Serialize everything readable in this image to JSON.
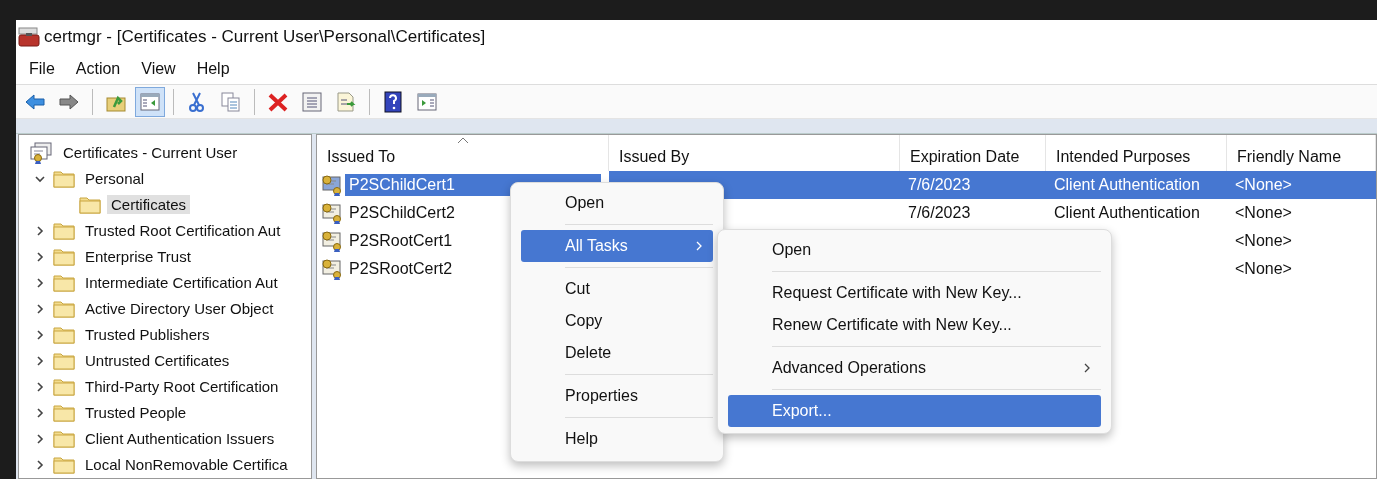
{
  "window": {
    "title": "certmgr - [Certificates - Current User\\Personal\\Certificates]"
  },
  "menu_bar": [
    "File",
    "Action",
    "View",
    "Help"
  ],
  "toolbar": [
    {
      "kind": "back",
      "pressed": false
    },
    {
      "kind": "forward",
      "pressed": false
    },
    {
      "kind": "separator"
    },
    {
      "kind": "up",
      "pressed": false
    },
    {
      "kind": "tree",
      "pressed": true
    },
    {
      "kind": "separator"
    },
    {
      "kind": "cut",
      "pressed": false
    },
    {
      "kind": "copy",
      "pressed": false
    },
    {
      "kind": "separator"
    },
    {
      "kind": "delete",
      "pressed": false
    },
    {
      "kind": "properties",
      "pressed": false
    },
    {
      "kind": "export",
      "pressed": false
    },
    {
      "kind": "separator"
    },
    {
      "kind": "help",
      "pressed": false
    },
    {
      "kind": "action-pane",
      "pressed": false
    }
  ],
  "tree": {
    "label": "Certificates - Current User",
    "children": [
      {
        "label": "Personal",
        "expanded": true,
        "selected": false,
        "children": [
          {
            "label": "Certificates",
            "selected": true
          }
        ]
      },
      {
        "label": "Trusted Root Certification Aut",
        "expanded": false,
        "selected": false
      },
      {
        "label": "Enterprise Trust",
        "expanded": false,
        "selected": false
      },
      {
        "label": "Intermediate Certification Aut",
        "expanded": false,
        "selected": false
      },
      {
        "label": "Active Directory User Object",
        "expanded": false,
        "selected": false
      },
      {
        "label": "Trusted Publishers",
        "expanded": false,
        "selected": false
      },
      {
        "label": "Untrusted Certificates",
        "expanded": false,
        "selected": false
      },
      {
        "label": "Third-Party Root Certification",
        "expanded": false,
        "selected": false
      },
      {
        "label": "Trusted People",
        "expanded": false,
        "selected": false
      },
      {
        "label": "Client Authentication Issuers",
        "expanded": false,
        "selected": false
      },
      {
        "label": "Local NonRemovable Certifica",
        "expanded": false,
        "selected": false
      }
    ]
  },
  "table": {
    "columns": [
      "Issued To",
      "Issued By",
      "Expiration Date",
      "Intended Purposes",
      "Friendly Name"
    ],
    "rows": [
      {
        "issued_to": "P2SChildCert1",
        "expiration": "7/6/2023",
        "purposes": "Client Authentication",
        "friendly_name": "<None>",
        "selected": true
      },
      {
        "issued_to": "P2SChildCert2",
        "expiration": "7/6/2023",
        "purposes": "Client Authentication",
        "friendly_name": "<None>",
        "selected": false
      },
      {
        "issued_to": "P2SRootCert1",
        "friendly_name": "<None>",
        "selected": false
      },
      {
        "issued_to": "P2SRootCert2",
        "friendly_name": "<None>",
        "selected": false
      }
    ]
  },
  "context_menu": {
    "items": [
      {
        "kind": "item",
        "label": "Open",
        "selected": false,
        "submenu": false
      },
      {
        "kind": "separator"
      },
      {
        "kind": "item",
        "label": "All Tasks",
        "selected": true,
        "submenu": true
      },
      {
        "kind": "separator"
      },
      {
        "kind": "item",
        "label": "Cut",
        "selected": false,
        "submenu": false
      },
      {
        "kind": "item",
        "label": "Copy",
        "selected": false,
        "submenu": false
      },
      {
        "kind": "item",
        "label": "Delete",
        "selected": false,
        "submenu": false
      },
      {
        "kind": "separator"
      },
      {
        "kind": "item",
        "label": "Properties",
        "selected": false,
        "submenu": false
      },
      {
        "kind": "separator"
      },
      {
        "kind": "item",
        "label": "Help",
        "selected": false,
        "submenu": false
      }
    ]
  },
  "submenu": {
    "items": [
      {
        "kind": "item",
        "label": "Open",
        "selected": false,
        "submenu": false
      },
      {
        "kind": "separator"
      },
      {
        "kind": "item",
        "label": "Request Certificate with New Key...",
        "selected": false,
        "submenu": false
      },
      {
        "kind": "item",
        "label": "Renew Certificate with New Key...",
        "selected": false,
        "submenu": false
      },
      {
        "kind": "separator"
      },
      {
        "kind": "item",
        "label": "Advanced Operations",
        "selected": false,
        "submenu": true
      },
      {
        "kind": "separator"
      },
      {
        "kind": "item",
        "label": "Export...",
        "selected": true,
        "submenu": false
      }
    ]
  }
}
